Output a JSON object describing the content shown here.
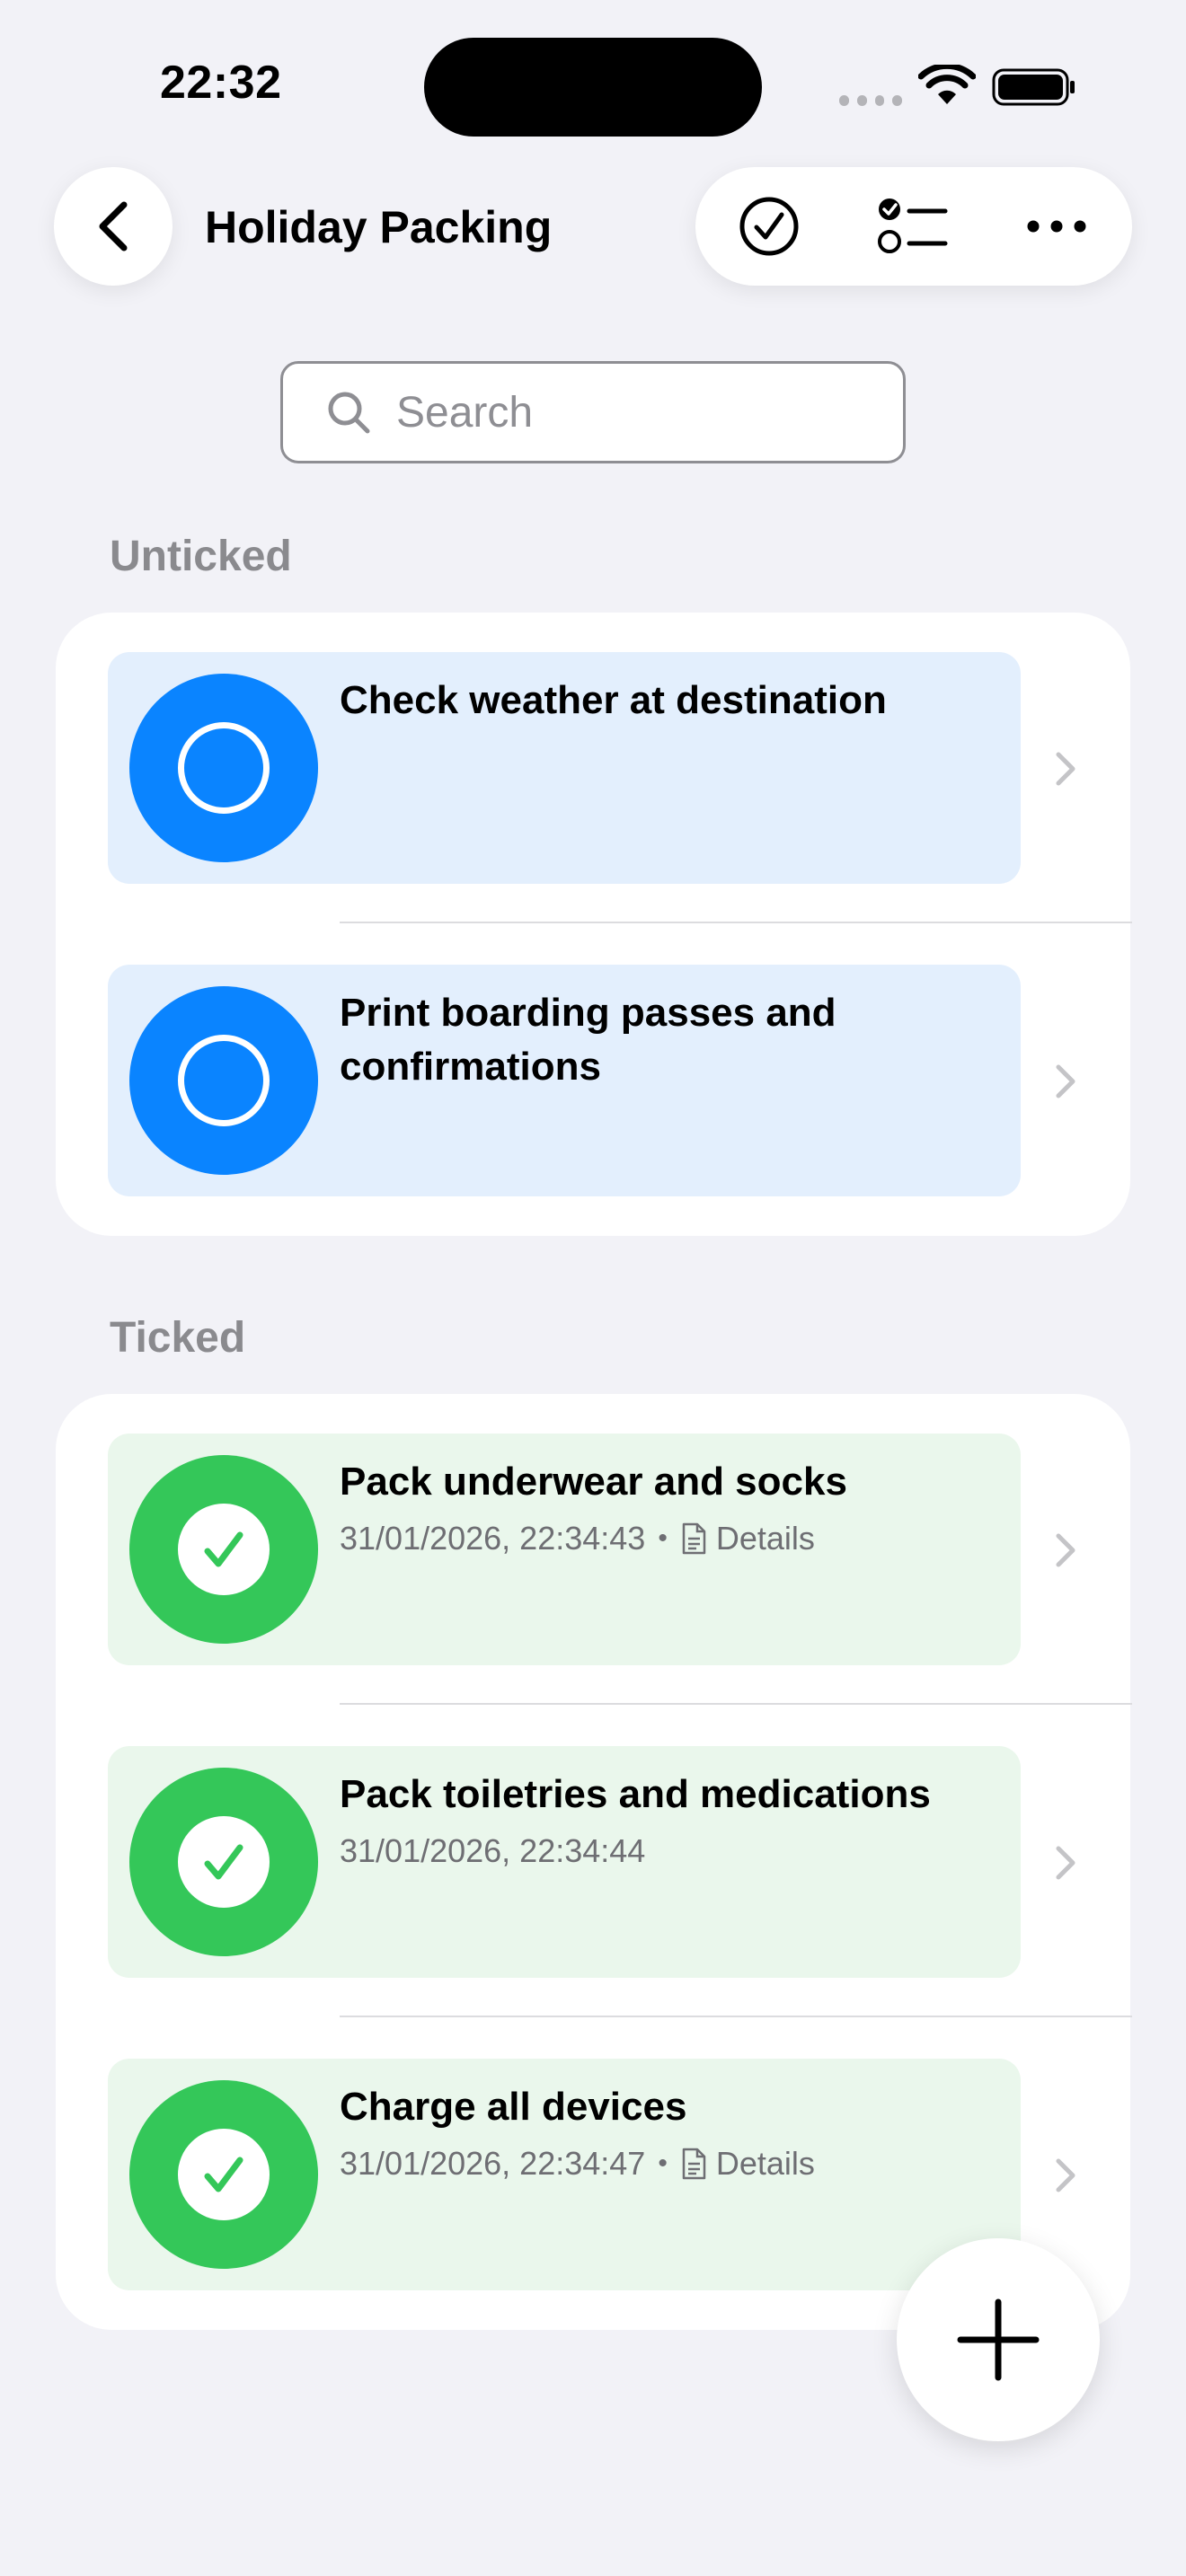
{
  "status_bar": {
    "time": "22:32"
  },
  "nav": {
    "title": "Holiday Packing"
  },
  "search": {
    "placeholder": "Search"
  },
  "sections": {
    "unticked": {
      "header": "Unticked",
      "items": [
        {
          "title": "Check weather at destination"
        },
        {
          "title": "Print boarding passes and confirmations"
        }
      ]
    },
    "ticked": {
      "header": "Ticked",
      "items": [
        {
          "title": "Pack underwear and socks",
          "timestamp": "31/01/2026, 22:34:43",
          "details": "Details"
        },
        {
          "title": "Pack toiletries and medications",
          "timestamp": "31/01/2026, 22:34:44"
        },
        {
          "title": "Charge all devices",
          "timestamp": "31/01/2026, 22:34:47",
          "details": "Details"
        }
      ]
    }
  },
  "colors": {
    "accent_blue": "#0a84ff",
    "tick_green": "#34c759",
    "background": "#f2f2f7"
  },
  "icons": {
    "back": "chevron-left-icon",
    "select": "checkmark-circle-icon",
    "checklist": "checklist-icon",
    "more": "ellipsis-icon",
    "search": "magnifier-icon",
    "add": "plus-icon"
  }
}
